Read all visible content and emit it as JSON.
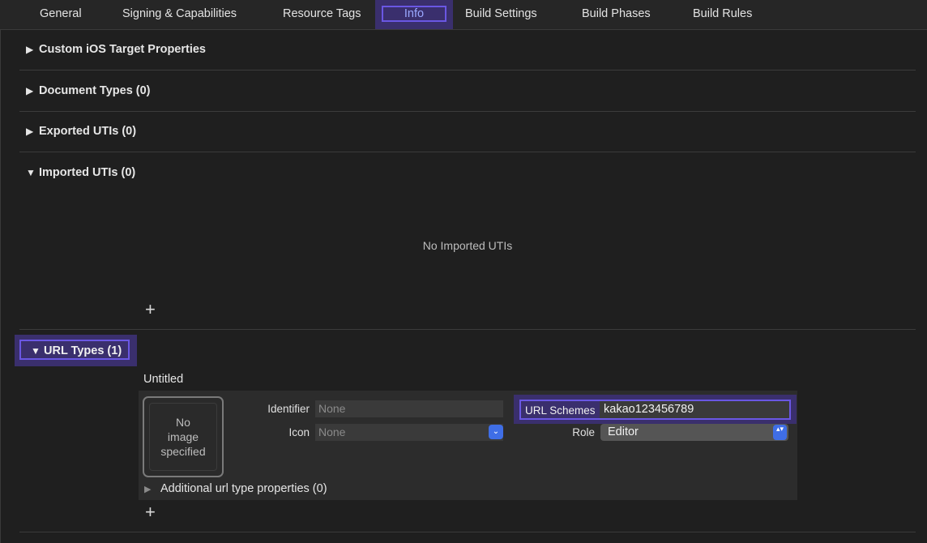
{
  "tabs": {
    "general": "General",
    "signing": "Signing & Capabilities",
    "resource_tags": "Resource Tags",
    "info": "Info",
    "build_settings": "Build Settings",
    "build_phases": "Build Phases",
    "build_rules": "Build Rules",
    "selected": "Info"
  },
  "sections": {
    "custom_ios": {
      "title": "Custom iOS Target Properties",
      "expanded": false
    },
    "document_types": {
      "title": "Document Types (0)",
      "expanded": false
    },
    "exported_utis": {
      "title": "Exported UTIs (0)",
      "expanded": false
    },
    "imported_utis": {
      "title": "Imported UTIs (0)",
      "expanded": true,
      "empty_message": "No Imported UTIs"
    },
    "url_types": {
      "title": "URL Types (1)",
      "expanded": true
    }
  },
  "glyphs": {
    "collapsed": "▶",
    "expanded": "▼",
    "plus": "+",
    "chevron_down": "⌄",
    "updown": "▴▾"
  },
  "url_type": {
    "name": "Untitled",
    "image_placeholder_1": "No",
    "image_placeholder_2": "image",
    "image_placeholder_3": "specified",
    "identifier_label": "Identifier",
    "identifier_placeholder": "None",
    "icon_label": "Icon",
    "icon_placeholder": "None",
    "url_schemes_label": "URL Schemes",
    "url_schemes_value": "kakao123456789",
    "role_label": "Role",
    "role_value": "Editor",
    "additional_label": "Additional url type properties (0)"
  },
  "colors": {
    "background": "#1f1f1f",
    "highlight_fill": "#3a2f6d",
    "highlight_border": "#6a57e3",
    "accent_blue": "#3f6ee6"
  }
}
